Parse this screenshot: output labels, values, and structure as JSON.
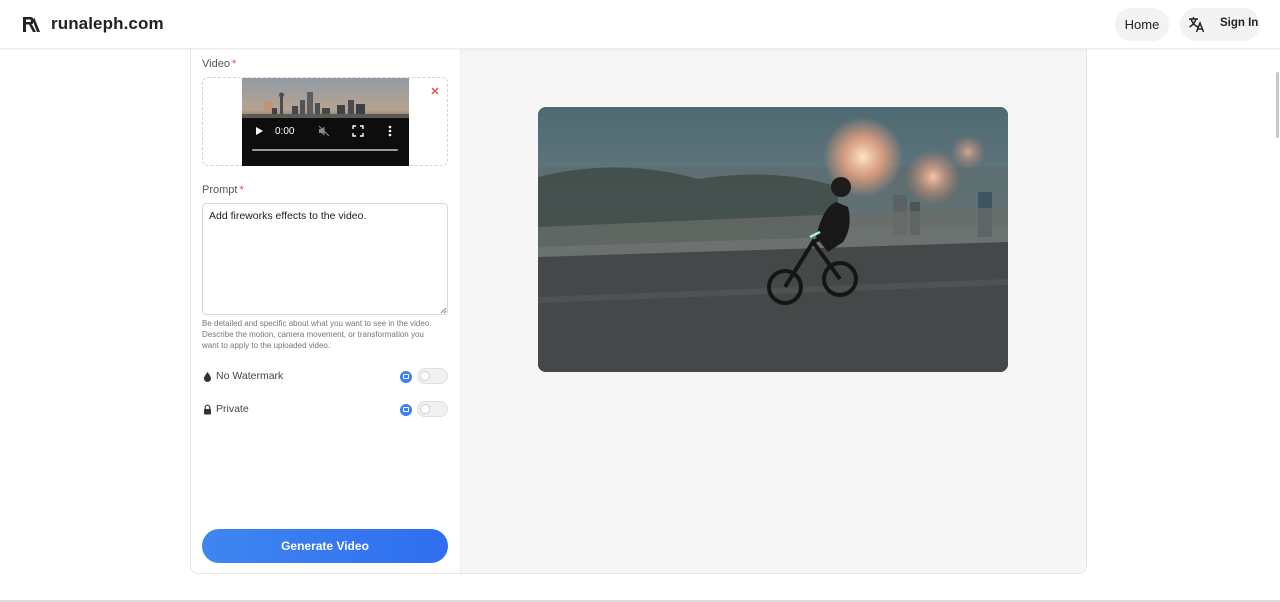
{
  "header": {
    "brand": "runaleph.com",
    "home_label": "Home",
    "signin_label": "Sign In",
    "logo_icon": "runaleph-logo-icon",
    "translate_icon": "translate-icon"
  },
  "form": {
    "video_label": "Video",
    "required_mark": "*",
    "video_player": {
      "time": "0:00"
    },
    "prompt_label": "Prompt",
    "prompt_value": "Add fireworks effects to the video.",
    "prompt_hint": "Be detailed and specific about what you want to see in the video. Describe the motion, camera movement, or transformation you want to apply to the uploaded video.",
    "options": [
      {
        "label": "No Watermark",
        "icon": "droplet-icon",
        "enabled": false
      },
      {
        "label": "Private",
        "icon": "lock-icon",
        "enabled": false
      }
    ],
    "generate_label": "Generate Video"
  },
  "colors": {
    "accent": "#2f6ef0",
    "required": "#e5484d",
    "panel_bg": "#f6f6f6"
  }
}
